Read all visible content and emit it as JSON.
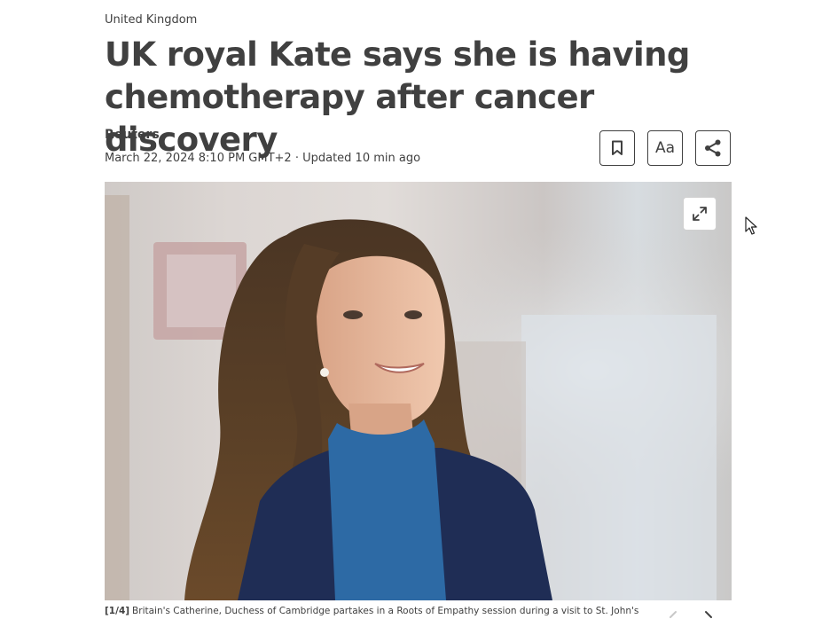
{
  "article": {
    "category": "United Kingdom",
    "headline": "UK royal Kate says she is having chemotherapy after cancer discovery",
    "source": "Reuters",
    "dateline": "March 22, 2024 8:10 PM GMT+2 · Updated 10 min ago"
  },
  "toolbar": {
    "bookmark_icon": "bookmark-icon",
    "font_size_label": "Aa",
    "share_icon": "share-icon"
  },
  "photo": {
    "expand_icon": "expand-icon",
    "counter": "[1/4]",
    "caption": "Britain's Catherine, Duchess of Cambridge partakes in a Roots of Empathy session during a visit to St. John's",
    "prev_icon": "chevron-left-icon",
    "next_icon": "chevron-right-icon"
  },
  "colors": {
    "text": "#404040",
    "background": "#ffffff",
    "coat": "#1f2d55",
    "blouse": "#2d6aa5"
  }
}
